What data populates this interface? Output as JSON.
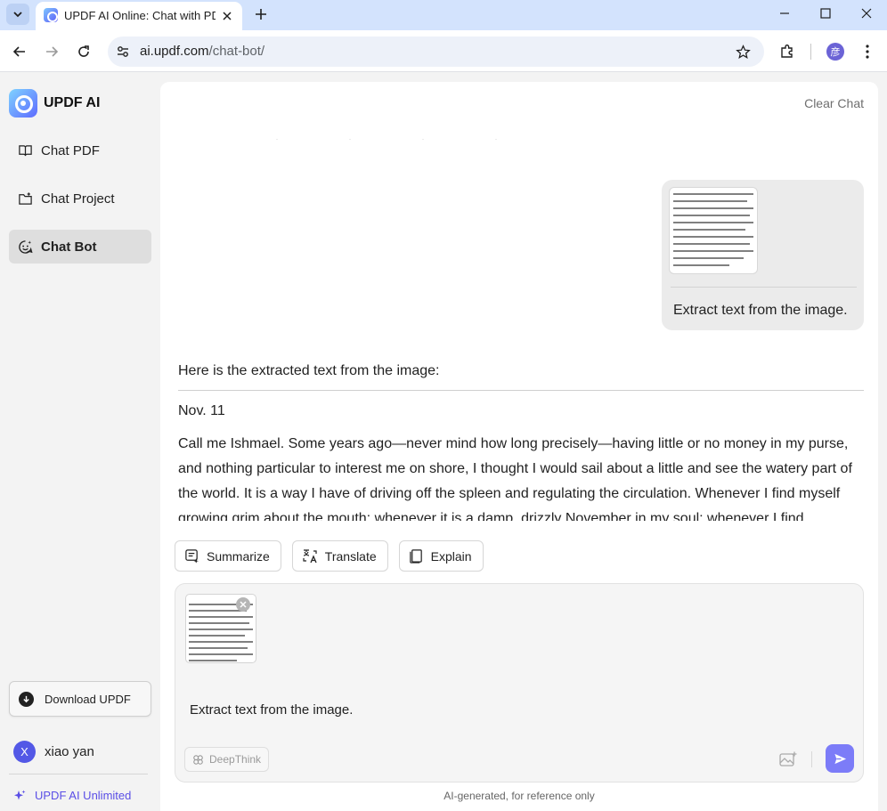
{
  "browser": {
    "tab_title": "UPDF AI Online: Chat with PDF",
    "url_host": "ai.updf.com",
    "url_path": "/chat-bot/",
    "profile_initial": "彦"
  },
  "sidebar": {
    "brand": "UPDF AI",
    "items": [
      {
        "label": "Chat PDF",
        "icon": "book-icon"
      },
      {
        "label": "Chat Project",
        "icon": "folder-icon"
      },
      {
        "label": "Chat Bot",
        "icon": "bot-icon",
        "active": true
      }
    ],
    "download_label": "Download UPDF",
    "user_initial": "X",
    "user_name": "xiao yan",
    "unlimited_label": "UPDF AI Unlimited"
  },
  "chat": {
    "clear_label": "Clear Chat",
    "user_message": "Extract text from the image.",
    "ai_intro": "Here is the extracted text from the image:",
    "ai_date": "Nov. 11",
    "ai_body": "Call me Ishmael. Some years ago—never mind how long precisely—having little or no money in my purse, and nothing particular to interest me on shore, I thought I would sail about a little and see the watery part of the world. It is a way I have of driving off the spleen and regulating the circulation. Whenever I find myself growing grim about the mouth; whenever it is a damp, drizzly November in my soul; whenever I find",
    "actions": [
      {
        "label": "Summarize",
        "icon": "summarize-icon"
      },
      {
        "label": "Translate",
        "icon": "translate-icon"
      },
      {
        "label": "Explain",
        "icon": "explain-icon"
      }
    ]
  },
  "composer": {
    "input_value": "Extract text from the image.",
    "deepthink_label": "DeepThink",
    "disclaimer": "AI-generated, for reference only"
  },
  "colors": {
    "accent": "#7c7cf8",
    "brand_purple": "#5a4ee6",
    "tabbar_bg": "#d3e3fd"
  }
}
